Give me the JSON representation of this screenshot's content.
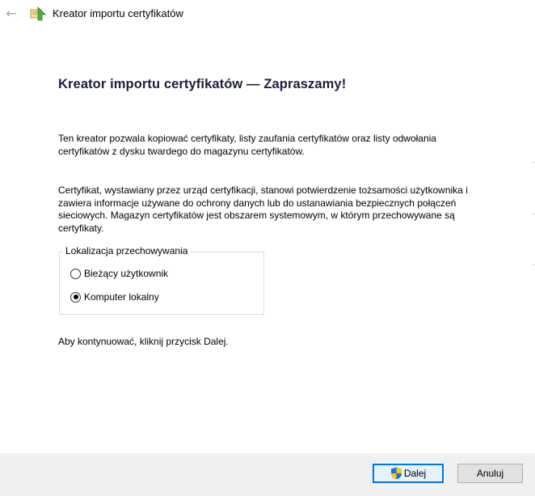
{
  "window": {
    "title": "Kreator importu certyfikatów",
    "back_icon": "back-arrow-icon",
    "app_icon": "certificate-wizard-icon"
  },
  "content": {
    "heading": "Kreator importu certyfikatów — Zapraszamy!",
    "paragraph1": "Ten kreator pozwala kopiować certyfikaty, listy zaufania certyfikatów oraz listy odwołania certyfikatów z dysku twardego do magazynu certyfikatów.",
    "paragraph2": "Certyfikat, wystawiany przez urząd certyfikacji, stanowi potwierdzenie tożsamości użytkownika i zawiera informacje używane do ochrony danych lub do ustanawiania bezpiecznych połączeń sieciowych. Magazyn certyfikatów jest obszarem systemowym, w którym przechowywane są certyfikaty.",
    "store_location": {
      "legend": "Lokalizacja przechowywania",
      "options": [
        {
          "label": "Bieżący użytkownik",
          "selected": false
        },
        {
          "label": "Komputer lokalny",
          "selected": true
        }
      ]
    },
    "paragraph3": "Aby kontynuować, kliknij przycisk Dalej."
  },
  "footer": {
    "next_label": "Dalej",
    "next_icon": "uac-shield-icon",
    "cancel_label": "Anuluj"
  }
}
